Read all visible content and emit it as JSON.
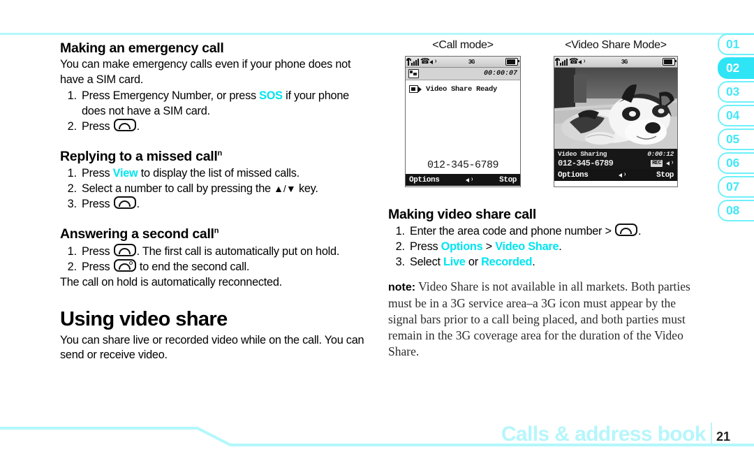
{
  "colors": {
    "accent": "#00e4f0",
    "rule": "#b3f7fb",
    "tab_active_bg": "#2fe4f5",
    "footer_title": "#b6f6fb"
  },
  "left_column": {
    "emergency": {
      "heading": "Making an emergency call",
      "intro": "You can make emergency calls even if your phone does not have a SIM card.",
      "step1_a": "Press Emergency Number, or press ",
      "step1_accent": "SOS",
      "step1_b": " if your phone does not have a SIM card.",
      "step2_a": "Press ",
      "step2_b": "."
    },
    "missed": {
      "heading": "Replying to a missed call",
      "heading_sup": "n",
      "step1_a": "Press ",
      "step1_accent": "View",
      "step1_b": " to display the list of missed calls.",
      "step2_a": "Select a number to call by pressing the ",
      "step2_keys": "▲/▼",
      "step2_b": " key.",
      "step3_a": "Press ",
      "step3_b": "."
    },
    "second_call": {
      "heading": "Answering a second call",
      "heading_sup": "n",
      "step1_a": "Press ",
      "step1_b": ". The first call is automatically put on hold.",
      "step2_a": "Press ",
      "step2_b": " to end the second call.",
      "closing": "The call on hold is automatically reconnected."
    },
    "video_share": {
      "heading": "Using video share",
      "body": "You can share live or recorded video while on the call. You can send or receive video."
    }
  },
  "phones": [
    {
      "caption": "<Call mode>",
      "mode": "call",
      "status": {
        "signal_icon": "signal-bars-icon",
        "handset_icon": "handset-icon",
        "speaker_icon": "speaker-icon",
        "network": "3G",
        "battery_icon": "battery-icon"
      },
      "call_icon": "video-share-indicator-icon",
      "timer": "00:00:07",
      "ready_icon": "camcorder-icon",
      "ready_text": "Video Share Ready",
      "number": "012-345-6789",
      "softkeys": {
        "left": "Options",
        "center_icon": "speaker-icon",
        "right": "Stop"
      }
    },
    {
      "caption": "<Video Share Mode>",
      "mode": "video",
      "status": {
        "signal_icon": "signal-bars-icon",
        "handset_icon": "handset-icon",
        "speaker_icon": "speaker-icon",
        "network": "3G",
        "battery_icon": "battery-icon"
      },
      "viewfinder_alt": "husky puppy lying on floor",
      "info_label": "Video Sharing",
      "info_timer": "0:00:12",
      "number": "012-345-6789",
      "rec_badge": "REC",
      "rec_speaker_icon": "speaker-icon",
      "softkeys": {
        "left": "Options",
        "center_icon": "speaker-icon",
        "right": "Stop"
      }
    }
  ],
  "right_column": {
    "making_call": {
      "heading": "Making video share call",
      "step1_a": "Enter the area code and phone number > ",
      "step1_b": ".",
      "step2_a": "Press ",
      "step2_accent1": "Options",
      "step2_mid": " > ",
      "step2_accent2": "Video Share",
      "step2_b": ".",
      "step3_a": "Select ",
      "step3_accent1": "Live",
      "step3_mid": " or ",
      "step3_accent2": "Recorded",
      "step3_b": "."
    },
    "note": {
      "label": "note:",
      "text": " Video Share is not available in all markets. Both parties must be in a 3G service area–a 3G icon must appear by the signal bars prior to a call being placed, and both parties must remain in the 3G coverage area for the duration of the Video Share."
    }
  },
  "tabs": [
    {
      "label": "01",
      "active": false
    },
    {
      "label": "02",
      "active": true
    },
    {
      "label": "03",
      "active": false
    },
    {
      "label": "04",
      "active": false
    },
    {
      "label": "05",
      "active": false
    },
    {
      "label": "06",
      "active": false
    },
    {
      "label": "07",
      "active": false
    },
    {
      "label": "08",
      "active": false
    }
  ],
  "footer": {
    "title": "Calls & address book",
    "page": "21"
  }
}
